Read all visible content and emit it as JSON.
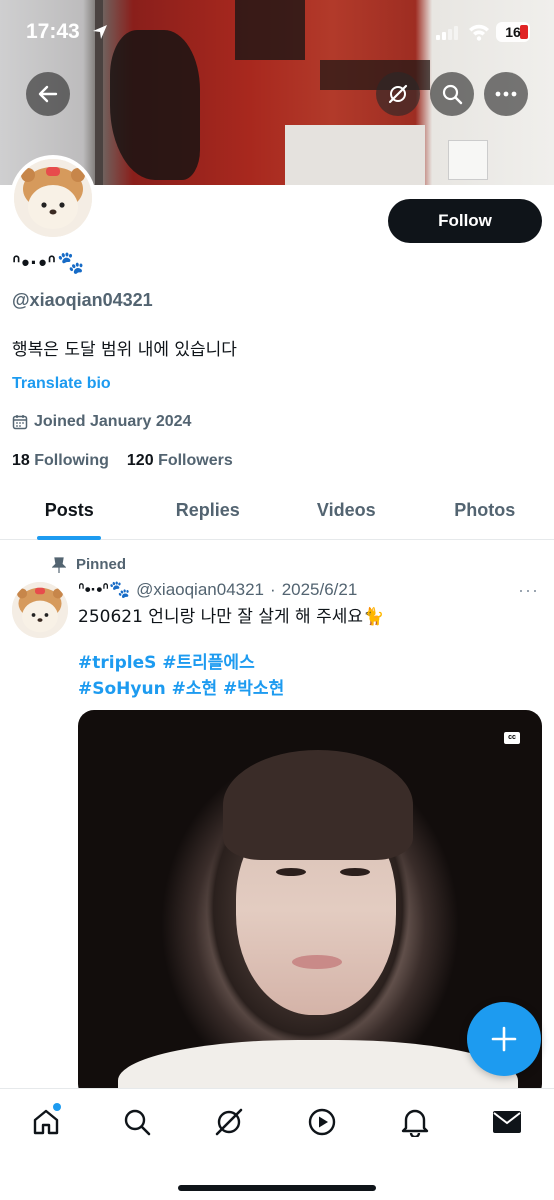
{
  "status_bar": {
    "time": "17:43",
    "battery": "16"
  },
  "profile": {
    "display_name": "ᐢ•·•ᐢ🐾",
    "handle": "@xiaoqian04321",
    "bio": "행복은 도달 범위 내에 있습니다",
    "translate_label": "Translate bio",
    "joined": "Joined January 2024",
    "following_count": "18",
    "following_label": "Following",
    "followers_count": "120",
    "followers_label": "Followers",
    "follow_label": "Follow"
  },
  "tabs": [
    {
      "label": "Posts",
      "active": true
    },
    {
      "label": "Replies",
      "active": false
    },
    {
      "label": "Videos",
      "active": false
    },
    {
      "label": "Photos",
      "active": false
    }
  ],
  "post": {
    "pinned_label": "Pinned",
    "author_name": "ᐢ•·•ᐢ🐾",
    "author_handle": "@xiaoqian04321",
    "separator": "·",
    "date": "2025/6/21",
    "more": "···",
    "text": "250621 언니랑 나만 잘 살게 해 주세요🐈",
    "hashtags_line1": "#tripleS #트리플에스",
    "hashtags_line2": "#SoHyun #소현 #박소현",
    "media_badge": "cc"
  },
  "icons": {
    "back": "back-arrow-icon",
    "grok": "grok-icon",
    "search": "search-icon",
    "more": "more-icon",
    "calendar": "calendar-icon",
    "pin": "pin-icon",
    "compose": "plus-icon",
    "nav": [
      "home-icon",
      "search-icon",
      "grok-icon",
      "play-icon",
      "bell-icon",
      "mail-icon"
    ]
  },
  "colors": {
    "accent": "#1d9bf0",
    "text": "#0f1419",
    "muted": "#536471"
  }
}
